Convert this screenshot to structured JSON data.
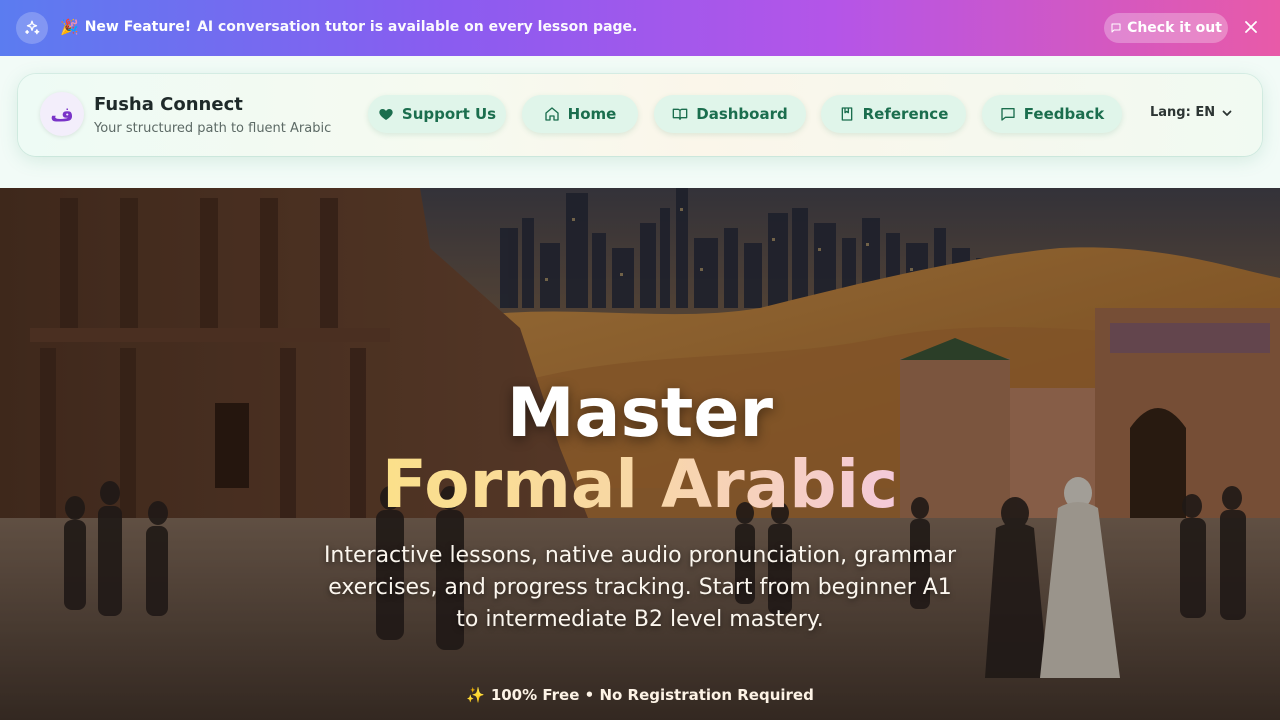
{
  "announcement": {
    "emoji": "🎉",
    "highlight": "New Feature!",
    "message": "AI conversation tutor is available on every lesson page.",
    "cta_label": "Check it out"
  },
  "header": {
    "logo_glyph": "ف",
    "brand_title": "Fusha Connect",
    "brand_subtitle": "Your structured path to fluent Arabic",
    "nav": {
      "support": "Support Us",
      "home": "Home",
      "dashboard": "Dashboard",
      "reference": "Reference",
      "feedback": "Feedback"
    },
    "language_label": "Lang: EN"
  },
  "hero": {
    "title_line1": "Master",
    "title_line2": "Formal Arabic",
    "subtitle": "Interactive lessons, native audio pronunciation, grammar exercises, and progress tracking. Start from beginner A1 to intermediate B2 level mastery.",
    "badge_emoji": "✨",
    "badge_text": "100% Free • No Registration Required"
  },
  "colors": {
    "accent_green": "#1b6e4e",
    "pill_bg": "#e0f5ea",
    "brand_purple": "#7a34c8",
    "title_gold": "#fbe08a"
  },
  "icons": [
    "sparkle-icon",
    "party-popper-icon",
    "chat-bubble-icon",
    "close-icon",
    "heart-icon",
    "home-icon",
    "book-open-icon",
    "bookmark-book-icon",
    "message-square-icon",
    "chevron-down-icon",
    "sparkles-emoji-icon"
  ]
}
